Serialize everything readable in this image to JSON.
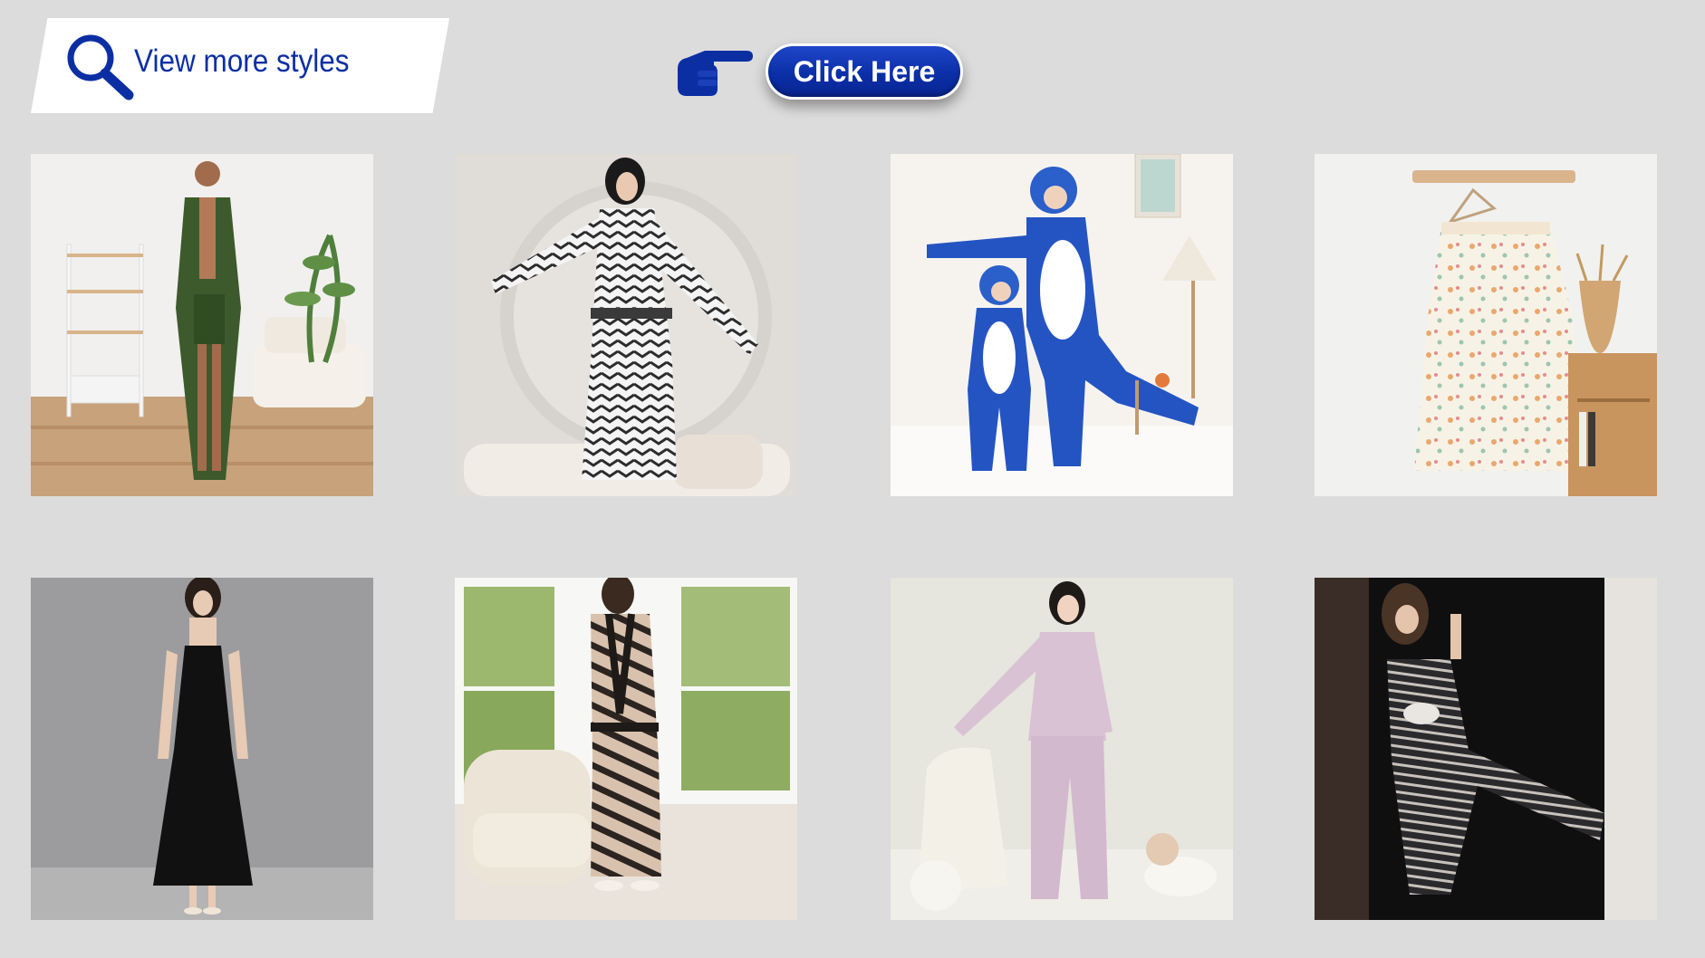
{
  "header": {
    "banner_label": "View more styles",
    "search_icon": "magnifier-icon",
    "pointer_icon": "pointing-hand-icon",
    "cta_label": "Click Here"
  },
  "colors": {
    "page_background": "#dcdcdc",
    "brand_blue": "#0b2fa3",
    "banner_background": "#ffffff"
  },
  "products": [
    {
      "name": "green satin robe and shorts set"
    },
    {
      "name": "zebra chevron plush bathrobe"
    },
    {
      "name": "blue shark onesie pajamas"
    },
    {
      "name": "floral cami nightgown"
    },
    {
      "name": "black satin slip nightdress"
    },
    {
      "name": "zebra print kimono robe"
    },
    {
      "name": "lilac satin pajama set"
    },
    {
      "name": "striped cami jumpsuit"
    }
  ]
}
